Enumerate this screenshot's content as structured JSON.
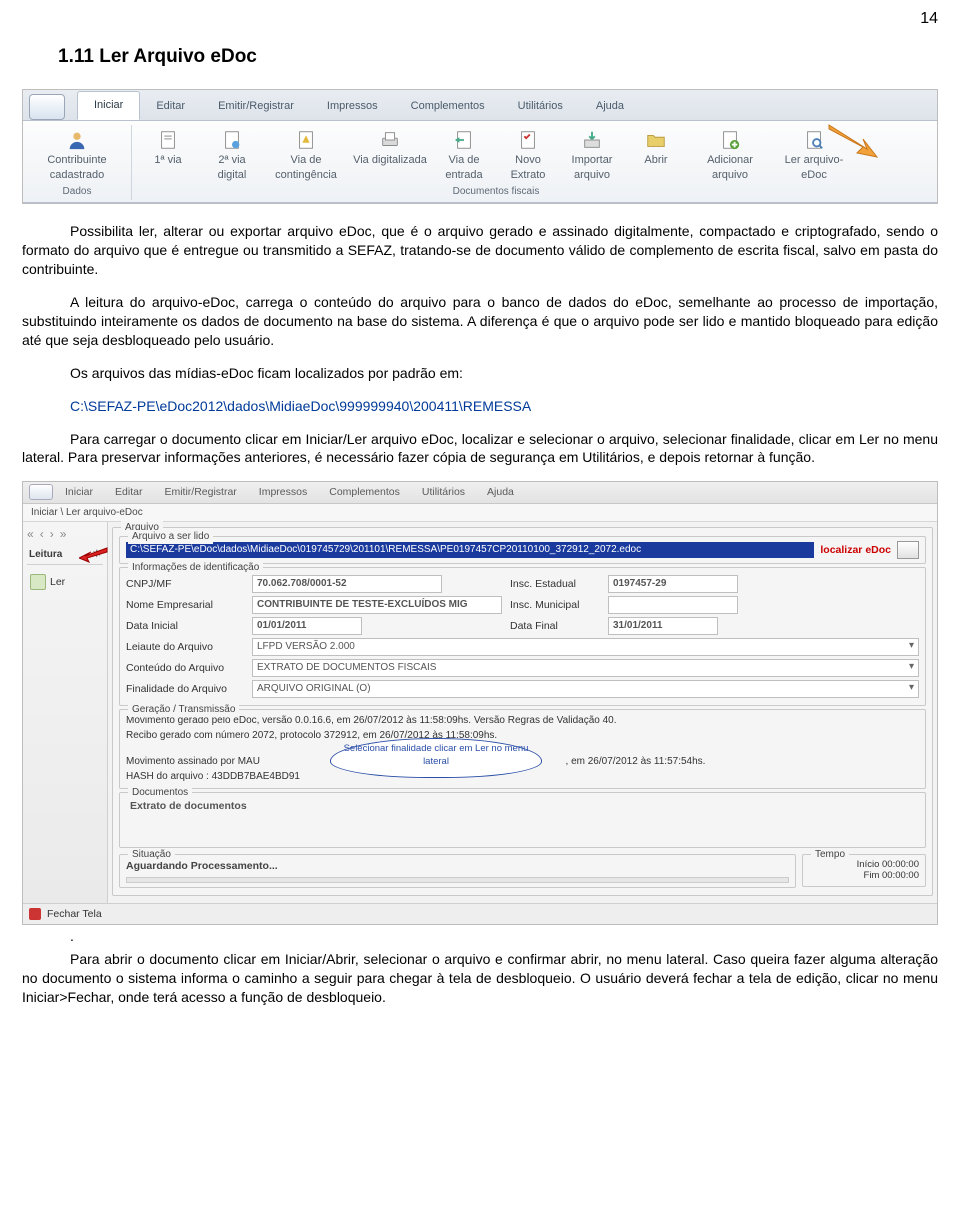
{
  "page_number": "14",
  "section_title": "1.11 Ler Arquivo eDoc",
  "paragraphs": {
    "p1": "Possibilita ler, alterar ou exportar arquivo eDoc, que é o arquivo gerado e assinado digitalmente, compactado e criptografado, sendo o formato do arquivo que é entregue ou transmitido a SEFAZ, tratando-se de documento válido de complemento de escrita fiscal, salvo em pasta do contribuinte.",
    "p2": "A leitura do arquivo-eDoc, carrega o conteúdo do arquivo para o banco de dados do eDoc, semelhante ao processo de importação, substituindo inteiramente os dados de documento na base do sistema. A diferença é que o arquivo pode ser lido e mantido bloqueado para edição até que seja desbloqueado pelo usuário.",
    "p3": "Os arquivos das mídias-eDoc ficam localizados por padrão em:",
    "path": "C:\\SEFAZ-PE\\eDoc2012\\dados\\MidiaeDoc\\999999940\\200411\\REMESSA",
    "p4": "Para carregar o documento clicar em Iniciar/Ler arquivo eDoc, localizar e selecionar o arquivo, selecionar finalidade, clicar em Ler no menu lateral. Para preservar informações anteriores, é necessário fazer cópia de segurança em Utilitários, e depois retornar à função.",
    "p5_dot": ".",
    "p5": "Para abrir o documento clicar em Iniciar/Abrir, selecionar o arquivo e confirmar abrir, no menu lateral. Caso queira fazer alguma alteração no documento o sistema informa o caminho a seguir para chegar à tela de desbloqueio. O usuário deverá fechar a tela de edição, clicar no menu Iniciar>Fechar, onde terá acesso a função de desbloqueio."
  },
  "shot1": {
    "tabs": [
      "Iniciar",
      "Editar",
      "Emitir/Registrar",
      "Impressos",
      "Complementos",
      "Utilitários",
      "Ajuda"
    ],
    "group1_label": "Dados",
    "group2_label": "Documentos fiscais",
    "btn_contribuinte": "Contribuinte cadastrado",
    "btn_1via": "1ª via",
    "btn_2via": "2ª via digital",
    "btn_via_cont": "Via de contingência",
    "btn_via_dig": "Via digitalizada",
    "btn_via_ent": "Via de entrada",
    "btn_novo_extrato": "Novo Extrato",
    "btn_importar": "Importar arquivo",
    "btn_abrir": "Abrir",
    "btn_adicionar": "Adicionar arquivo",
    "btn_ler": "Ler arquivo-eDoc"
  },
  "shot2": {
    "tabs": [
      "Iniciar",
      "Editar",
      "Emitir/Registrar",
      "Impressos",
      "Complementos",
      "Utilitários",
      "Ajuda"
    ],
    "breadcrumb": "Iniciar \\ Ler arquivo-eDoc",
    "sidebar_head": "Leitura",
    "sidebar_chevron": "«",
    "sidebar_ler": "Ler",
    "fs_arquivo": "Arquivo",
    "fs_aserlido": "Arquivo a ser lido",
    "path_value": "C:\\SEFAZ-PE\\eDoc\\dados\\MidiaeDoc\\019745729\\201101\\REMESSA\\PE0197457CP20110100_372912_2072.edoc",
    "localizar": "localizar eDoc",
    "fs_info": "Informações de identificação",
    "lbl_cnpj": "CNPJ/MF",
    "val_cnpj": "70.062.708/0001-52",
    "lbl_insc_est": "Insc. Estadual",
    "val_insc_est": "0197457-29",
    "lbl_nome": "Nome Empresarial",
    "val_nome": "CONTRIBUINTE DE TESTE-EXCLUÍDOS MIG",
    "lbl_insc_mun": "Insc. Municipal",
    "lbl_data_ini": "Data Inicial",
    "val_data_ini": "01/01/2011",
    "lbl_data_fin": "Data Final",
    "val_data_fin": "31/01/2011",
    "lbl_leiaute": "Leiaute do Arquivo",
    "val_leiaute": "LFPD VERSÃO 2.000",
    "lbl_conteudo": "Conteúdo do Arquivo",
    "val_conteudo": "EXTRATO DE DOCUMENTOS FISCAIS",
    "lbl_finalidade": "Finalidade do Arquivo",
    "val_finalidade": "ARQUIVO ORIGINAL (O)",
    "fs_ger": "Geração / Transmissão",
    "ger_line1": "Movimento gerado pelo eDoc, versão 0.0.16.6, em 26/07/2012 às 11:58:09hs. Versão Regras de Validação 40.",
    "ger_line2": "Recibo gerado com número 2072, protocolo 372912, em 26/07/2012 às 11:58:09hs.",
    "ger_line3a": "Movimento assinado por MAU",
    "ger_line3b": ", em 26/07/2012 às 11:57:54hs.",
    "ger_line4": "HASH do arquivo : 43DDB7BAE4BD91",
    "callout": "Selecionar finalidade clicar em Ler no menu lateral",
    "fs_doc": "Documentos",
    "doc_text": "Extrato de documentos",
    "fs_sit": "Situação",
    "sit_text": "Aguardando Processamento...",
    "fs_tempo": "Tempo",
    "tempo_inicio": "Início 00:00:00",
    "tempo_fim": "Fim 00:00:00",
    "footer_close": "Fechar Tela"
  }
}
